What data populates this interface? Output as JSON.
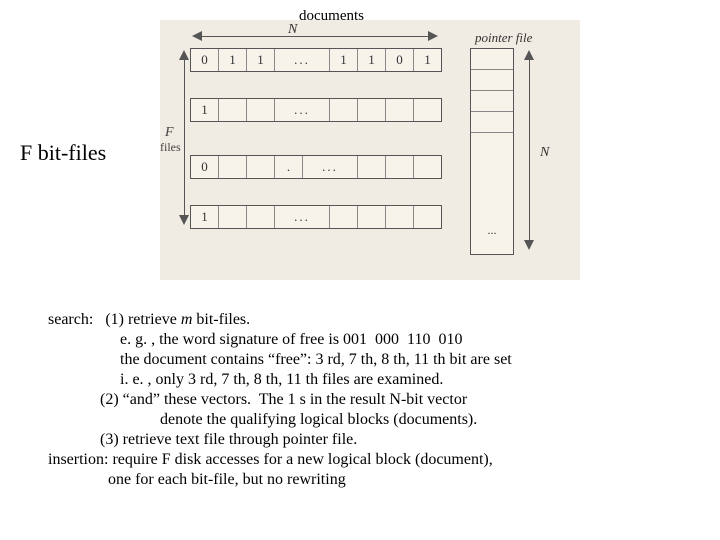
{
  "labels": {
    "documents": "documents",
    "f_bit_files": "F bit-files",
    "pointer_file": "pointer file",
    "N": "N",
    "F": "F",
    "files": "files"
  },
  "bitrows": {
    "row1": [
      "0",
      "1",
      "1",
      "...",
      "1",
      "1",
      "0",
      "1"
    ],
    "row2": [
      "1",
      "",
      "",
      "...",
      "",
      "",
      "",
      ""
    ],
    "row3": [
      "0",
      "",
      "",
      ".",
      "...",
      "",
      "",
      ""
    ],
    "row4": [
      "1",
      "",
      "",
      "...",
      "",
      "",
      "",
      ""
    ]
  },
  "pointer_ellipsis": "...",
  "text": {
    "search_label": "search:",
    "step1_a": "(1) retrieve ",
    "step1_m": "m",
    "step1_b": " bit-files.",
    "eg": "e. g. , the word signature of free is 001  000  110  010",
    "doc_contains": "the document contains “free”: 3 rd, 7 th, 8 th, 11 th bit are set",
    "ie": "i. e. , only 3 rd, 7 th, 8 th, 11 th files are examined.",
    "step2a": "(2) “and” these vectors.  The 1 s in the result N-bit vector",
    "step2b": "denote the qualifying logical blocks (documents).",
    "step3": "(3) retrieve text file through pointer file.",
    "insertion_label": "insertion:",
    "ins_a": " require F disk accesses for a new logical block (document),",
    "ins_b": "one for each bit-file, but no rewriting"
  }
}
